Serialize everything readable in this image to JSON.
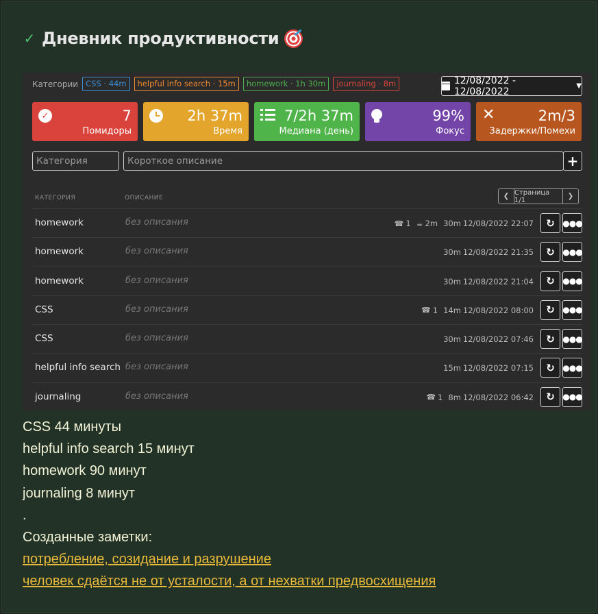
{
  "header": {
    "title": "Дневник продуктивности"
  },
  "categories": {
    "label": "Категории",
    "tags": [
      {
        "text": "CSS · 44m",
        "cls": "tag-css"
      },
      {
        "text": "helpful info search · 15m",
        "cls": "tag-info"
      },
      {
        "text": "homework · 1h 30m",
        "cls": "tag-hw"
      },
      {
        "text": "journaling · 8m",
        "cls": "tag-jr"
      }
    ]
  },
  "date_range": "12/08/2022 - 12/08/2022",
  "stats": [
    {
      "value": "7",
      "label": "Помидоры",
      "icon": "check-circle-icon"
    },
    {
      "value": "2h 37m",
      "label": "Время",
      "icon": "clock-icon"
    },
    {
      "value": "7/2h 37m",
      "label": "Медиана (день)",
      "icon": "list-icon"
    },
    {
      "value": "99%",
      "label": "Фокус",
      "icon": "lightbulb-icon"
    },
    {
      "value": "2m/3",
      "label": "Задержки/Помехи",
      "icon": "close-icon"
    }
  ],
  "inputs": {
    "category_placeholder": "Категория",
    "description_placeholder": "Короткое описание"
  },
  "table": {
    "col_category": "КАТЕГОРИЯ",
    "col_description": "ОПИСАНИЕ",
    "pager": "Страница 1/1",
    "rows": [
      {
        "category": "homework",
        "description": "без описания",
        "calls": "1",
        "break": "2m",
        "duration": "30m",
        "datetime": "12/08/2022 22:07"
      },
      {
        "category": "homework",
        "description": "без описания",
        "calls": "",
        "break": "",
        "duration": "30m",
        "datetime": "12/08/2022 21:35"
      },
      {
        "category": "homework",
        "description": "без описания",
        "calls": "",
        "break": "",
        "duration": "30m",
        "datetime": "12/08/2022 21:04"
      },
      {
        "category": "CSS",
        "description": "без описания",
        "calls": "1",
        "break": "",
        "duration": "14m",
        "datetime": "12/08/2022 08:00"
      },
      {
        "category": "CSS",
        "description": "без описания",
        "calls": "",
        "break": "",
        "duration": "30m",
        "datetime": "12/08/2022 07:46"
      },
      {
        "category": "helpful info search",
        "description": "без описания",
        "calls": "",
        "break": "",
        "duration": "15m",
        "datetime": "12/08/2022 07:15"
      },
      {
        "category": "journaling",
        "description": "без описания",
        "calls": "1",
        "break": "",
        "duration": "8m",
        "datetime": "12/08/2022 06:42"
      }
    ]
  },
  "summary": {
    "lines": [
      "CSS 44 минуты",
      "helpful info search 15 минут",
      "homework 90 минут",
      "journaling 8 минут",
      "."
    ],
    "notes_label": "Созданные заметки:",
    "notes": [
      "потребление, созидание и разрушение",
      "человек сдаётся не от усталости, а от нехватки предвосхищения"
    ]
  }
}
